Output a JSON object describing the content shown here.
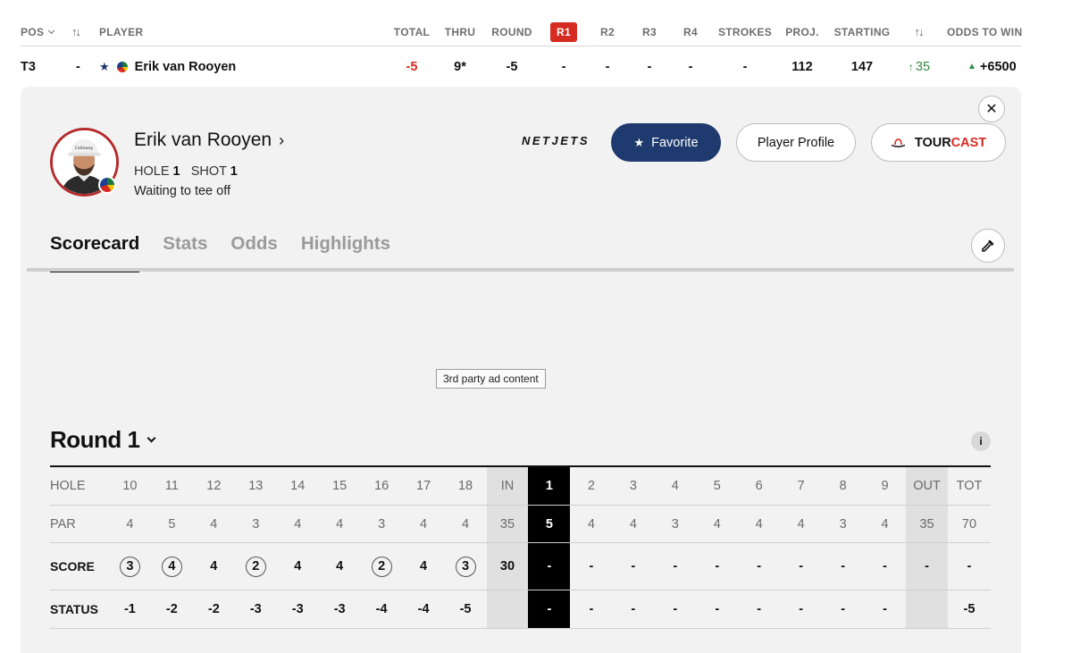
{
  "leaderboard": {
    "headers": {
      "pos": "POS",
      "player": "PLAYER",
      "total": "TOTAL",
      "thru": "THRU",
      "round": "ROUND",
      "r1": "R1",
      "r2": "R2",
      "r3": "R3",
      "r4": "R4",
      "strokes": "STROKES",
      "proj": "PROJ.",
      "starting": "STARTING",
      "odds": "ODDS TO WIN"
    },
    "row": {
      "pos": "T3",
      "movement": "-",
      "player": "Erik van Rooyen",
      "total": "-5",
      "thru": "9*",
      "round": "-5",
      "r1": "-",
      "r2": "-",
      "r3": "-",
      "r4": "-",
      "strokes": "-",
      "proj": "112",
      "starting": "147",
      "change": "35",
      "odds": "+6500"
    }
  },
  "player_panel": {
    "name": "Erik van Rooyen",
    "hole_label": "HOLE",
    "hole_value": "1",
    "shot_label": "SHOT",
    "shot_value": "1",
    "status": "Waiting to tee off",
    "sponsor": "NETJETS",
    "favorite_label": "Favorite",
    "profile_label": "Player Profile",
    "tourcast_a": "TOUR",
    "tourcast_b": "CAST",
    "tabs": [
      "Scorecard",
      "Stats",
      "Odds",
      "Highlights"
    ],
    "ad_text": "3rd party ad content"
  },
  "scorecard": {
    "round_label": "Round 1",
    "info": "i",
    "labels": {
      "hole": "HOLE",
      "par": "PAR",
      "score": "SCORE",
      "status": "STATUS"
    },
    "holes": [
      "10",
      "11",
      "12",
      "13",
      "14",
      "15",
      "16",
      "17",
      "18",
      "IN",
      "1",
      "2",
      "3",
      "4",
      "5",
      "6",
      "7",
      "8",
      "9",
      "OUT",
      "TOT"
    ],
    "par": [
      "4",
      "5",
      "4",
      "3",
      "4",
      "4",
      "3",
      "4",
      "4",
      "35",
      "5",
      "4",
      "4",
      "3",
      "4",
      "4",
      "4",
      "3",
      "4",
      "35",
      "70"
    ],
    "score": [
      "3",
      "4",
      "4",
      "2",
      "4",
      "4",
      "2",
      "4",
      "3",
      "30",
      "-",
      "-",
      "-",
      "-",
      "-",
      "-",
      "-",
      "-",
      "-",
      "-",
      "-"
    ],
    "status": [
      "-1",
      "-2",
      "-2",
      "-3",
      "-3",
      "-3",
      "-4",
      "-4",
      "-5",
      "",
      "-",
      "-",
      "-",
      "-",
      "-",
      "-",
      "-",
      "-",
      "-",
      "",
      "-5"
    ]
  },
  "colors": {
    "accent_red": "#d62b22",
    "favorite_navy": "#1e3a6e",
    "positive_green": "#2e8b43"
  }
}
